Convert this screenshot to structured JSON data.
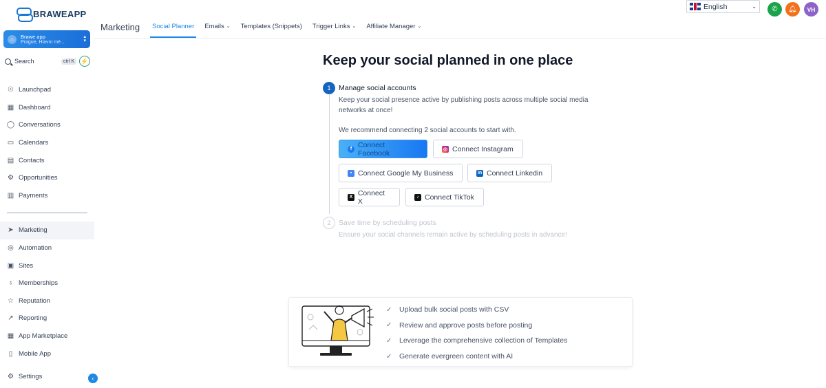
{
  "brand": {
    "logo_text": "BRAWEAPP"
  },
  "account": {
    "name": "Brawe app",
    "location": "Prague, Hlavní mě..."
  },
  "search": {
    "label": "Search",
    "shortcut": "ctrl K"
  },
  "sidebar": {
    "items": [
      {
        "label": "Launchpad",
        "icon": "rocket-icon"
      },
      {
        "label": "Dashboard",
        "icon": "dashboard-grid-icon"
      },
      {
        "label": "Conversations",
        "icon": "chat-bubble-icon"
      },
      {
        "label": "Calendars",
        "icon": "calendar-icon"
      },
      {
        "label": "Contacts",
        "icon": "contacts-card-icon"
      },
      {
        "label": "Opportunities",
        "icon": "funnel-icon"
      },
      {
        "label": "Payments",
        "icon": "receipt-icon"
      }
    ],
    "items2": [
      {
        "label": "Marketing",
        "icon": "paper-plane-icon",
        "active": true
      },
      {
        "label": "Automation",
        "icon": "automation-icon"
      },
      {
        "label": "Sites",
        "icon": "sites-icon"
      },
      {
        "label": "Memberships",
        "icon": "badge-icon"
      },
      {
        "label": "Reputation",
        "icon": "star-icon"
      },
      {
        "label": "Reporting",
        "icon": "trend-line-icon"
      },
      {
        "label": "App Marketplace",
        "icon": "grid-plus-icon"
      },
      {
        "label": "Mobile App",
        "icon": "mobile-icon"
      }
    ],
    "settings": "Settings"
  },
  "header": {
    "title": "Marketing",
    "tabs": [
      {
        "label": "Social Planner",
        "active": true,
        "dropdown": false
      },
      {
        "label": "Emails",
        "dropdown": true
      },
      {
        "label": "Templates (Snippets)",
        "dropdown": false
      },
      {
        "label": "Trigger Links",
        "dropdown": true
      },
      {
        "label": "Affiliate Manager",
        "dropdown": true
      }
    ],
    "language": "English",
    "avatar_initials": "VH"
  },
  "main": {
    "headline": "Keep your social planned in one place",
    "step1": {
      "number": "1",
      "title": "Manage social accounts",
      "description": "Keep your social presence active by publishing posts across multiple social media networks at once!",
      "recommend": "We recommend connecting 2 social accounts to start with."
    },
    "connect": {
      "facebook": "Connect Facebook",
      "instagram": "Connect Instagram",
      "gmb": "Connect Google My Business",
      "linkedin": "Connect Linkedin",
      "x": "Connect X",
      "tiktok": "Connect TikTok"
    },
    "step2": {
      "number": "2",
      "title": "Save time by scheduling posts",
      "description": "Ensure your social channels remain active by scheduling posts in advance!"
    },
    "features": [
      "Upload bulk social posts with CSV",
      "Review and approve posts before posting",
      "Leverage the comprehensive collection of Templates",
      "Generate evergreen content with AI"
    ]
  },
  "colors": {
    "accent": "#1e88e5",
    "phone": "#1aa34a",
    "bell": "#f2711c",
    "avatar": "#8e63c9"
  }
}
